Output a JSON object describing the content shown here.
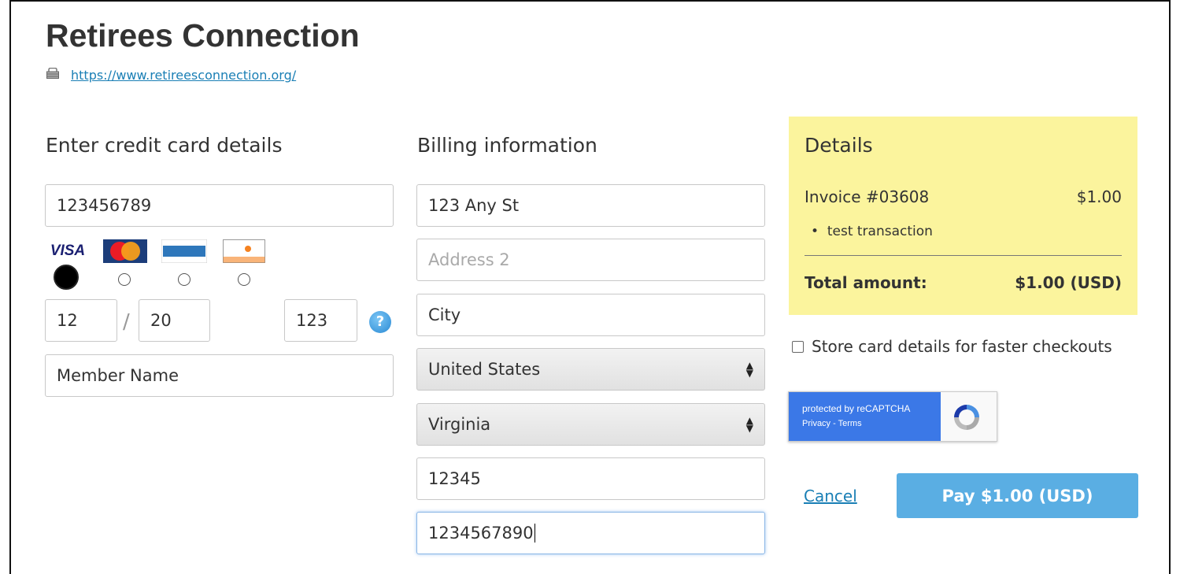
{
  "site": {
    "title": "Retirees Connection",
    "url": "https://www.retireesconnection.org/"
  },
  "card": {
    "heading": "Enter credit card details",
    "number": "123456789",
    "logos": [
      "VISA",
      "MasterCard",
      "AMEX",
      "DISCOVER"
    ],
    "selected_logo": "VISA",
    "exp_month": "12",
    "exp_year": "20",
    "cvv": "123",
    "help": "?",
    "name": "Member Name"
  },
  "billing": {
    "heading": "Billing information",
    "address1": "123 Any St",
    "address2_placeholder": "Address 2",
    "city": "City",
    "country": "United States",
    "state": "Virginia",
    "zip": "12345",
    "phone": "1234567890"
  },
  "details": {
    "heading": "Details",
    "invoice": "Invoice #03608",
    "invoice_amount": "$1.00",
    "item": "test transaction",
    "total_label": "Total amount:",
    "total_value": "$1.00 (USD)",
    "panel_color": "#fbf49d"
  },
  "store_card_label": "Store card details for faster checkouts",
  "recaptcha": {
    "line1": "protected by reCAPTCHA",
    "line2": "Privacy - Terms"
  },
  "actions": {
    "cancel": "Cancel",
    "pay": "Pay $1.00 (USD)",
    "pay_color": "#5aaee3"
  }
}
